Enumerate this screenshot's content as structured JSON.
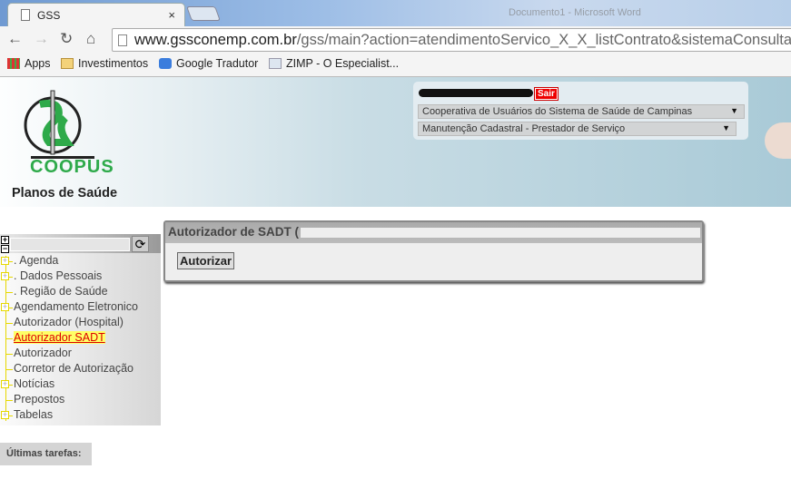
{
  "browser": {
    "tab_title": "GSS",
    "window_title": "Documento1 - Microsoft Word",
    "url_host": "www.gssconemp.com.br",
    "url_path": "/gss/main?action=atendimentoServico_X_X_listContrato&sistemaConsultaNom",
    "bookmarks": [
      {
        "label": "Apps",
        "icon": "apps-grid-icon"
      },
      {
        "label": "Investimentos",
        "icon": "folder-icon"
      },
      {
        "label": "Google Tradutor",
        "icon": "google-translate-icon"
      },
      {
        "label": "ZIMP - O Especialist...",
        "icon": "page-icon"
      }
    ]
  },
  "header": {
    "brand": "COOPUS",
    "tagline": "Planos de Saúde",
    "logout": "Sair",
    "cooperativa": "Cooperativa de Usuários do Sistema de Saúde de Campinas",
    "modulo": "Manutenção Cadastral - Prestador de Serviço"
  },
  "sidebar": {
    "items": [
      {
        "label": ". Agenda",
        "expandable": true
      },
      {
        "label": ". Dados Pessoais",
        "expandable": true
      },
      {
        "label": ". Região de Saúde",
        "expandable": false
      },
      {
        "label": "Agendamento Eletronico",
        "expandable": true
      },
      {
        "label": "Autorizador (Hospital)",
        "expandable": false
      },
      {
        "label": "Autorizador SADT",
        "expandable": false,
        "active": true
      },
      {
        "label": "Autorizador",
        "expandable": false
      },
      {
        "label": "Corretor de Autorização",
        "expandable": false
      },
      {
        "label": "Notícias",
        "expandable": true
      },
      {
        "label": "Prepostos",
        "expandable": false
      },
      {
        "label": "Tabelas",
        "expandable": true
      }
    ],
    "last_tasks": "Últimas tarefas:"
  },
  "panel": {
    "title": "Autorizador de SADT",
    "title_open": "(",
    "title_close": ")",
    "button": "Autorizar"
  },
  "colors": {
    "brand_green": "#2eaa4a",
    "active_link": "#dd0000",
    "highlight": "#ffff66",
    "logout_bg": "#ee0000"
  }
}
